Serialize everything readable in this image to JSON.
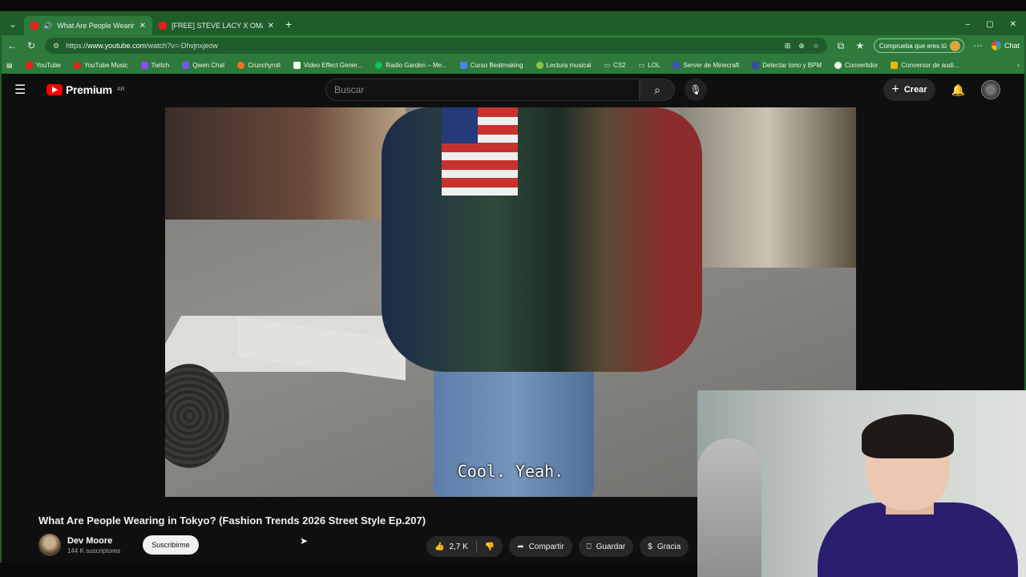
{
  "browser": {
    "tabs": [
      {
        "title": "What Are People Wearing in T",
        "active": true,
        "playing_audio": true
      },
      {
        "title": "[FREE] STEVE LACY X OMAR APOL",
        "active": false,
        "playing_audio": false
      }
    ],
    "new_tab": "+",
    "window_controls": [
      "–",
      "▢",
      "✕"
    ],
    "url_prefix": "https://",
    "url_host": "www.youtube.com",
    "url_path": "/watch?v=-Dhvjnxjeow",
    "password_pill": "Comprueba que eres tú",
    "chat_label": "Chat",
    "bookmarks": [
      {
        "label": "YouTube",
        "color": "#e62117"
      },
      {
        "label": "YouTube Music",
        "color": "#e62117"
      },
      {
        "label": "Twitch",
        "color": "#9146ff"
      },
      {
        "label": "Qwen Chat",
        "color": "#6c5ce7"
      },
      {
        "label": "Crunchyroll",
        "color": "#f47521"
      },
      {
        "label": "Video Effect Gener...",
        "color": "#ffffff"
      },
      {
        "label": "Radio Garden – Me...",
        "color": "#00c853"
      },
      {
        "label": "Curso Beatmaking",
        "color": "#4285f4"
      },
      {
        "label": "Lectura musical",
        "color": "#8bc34a"
      },
      {
        "label": "CS2",
        "color": "#cccccc"
      },
      {
        "label": "LOL",
        "color": "#cccccc"
      },
      {
        "label": "Server de Minecraft",
        "color": "#3f51b5"
      },
      {
        "label": "Detectar tono y BPM",
        "color": "#3949ab"
      },
      {
        "label": "Convertidor",
        "color": "#eeeeee"
      },
      {
        "label": "Conversor de audi...",
        "color": "#f4b400"
      }
    ]
  },
  "youtube": {
    "logo_text": "Premium",
    "logo_region": "AR",
    "search_placeholder": "Buscar",
    "create_label": "Crear",
    "video": {
      "subtitle": "Cool. Yeah.",
      "title": "What Are People Wearing in Tokyo? (Fashion Trends 2026 Street Style Ep.207)"
    },
    "channel": {
      "name": "Dev Moore",
      "subscribers": "144 K suscriptores",
      "subscribe_label": "Suscribirme"
    },
    "actions": {
      "likes": "2,7 K",
      "share": "Compartir",
      "save": "Guardar",
      "thanks": "Gracia"
    }
  }
}
